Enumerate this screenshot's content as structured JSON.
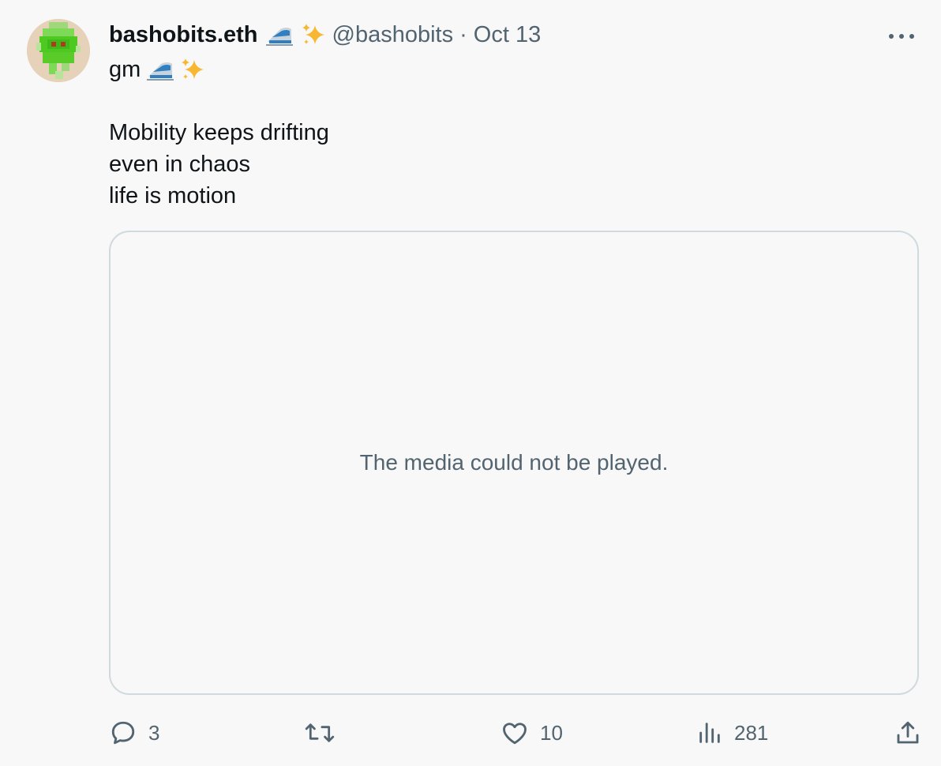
{
  "author": {
    "display_name": "bashobits.eth",
    "handle": "@bashobits",
    "separator": "·",
    "date": "Oct 13",
    "name_emojis": [
      "train-icon",
      "sparkles-icon"
    ]
  },
  "tweet": {
    "lines": [
      "gm",
      "",
      "Mobility keeps drifting",
      "even in chaos",
      "life is motion"
    ],
    "gm_emojis": [
      "train-icon",
      "sparkles-icon"
    ]
  },
  "media": {
    "message": "The media could not be played."
  },
  "actions": {
    "reply_count": "3",
    "retweet_count": "",
    "like_count": "10",
    "views_count": "281"
  },
  "icons": {
    "more": "more-horizontal-icon",
    "reply": "reply-icon",
    "retweet": "retweet-icon",
    "like": "heart-icon",
    "views": "views-icon",
    "share": "share-icon"
  },
  "colors": {
    "background": "#f7f8f7",
    "text": "#0f1419",
    "secondary": "#536471",
    "border": "#cfd9de",
    "sparkle": "#f7b733"
  }
}
